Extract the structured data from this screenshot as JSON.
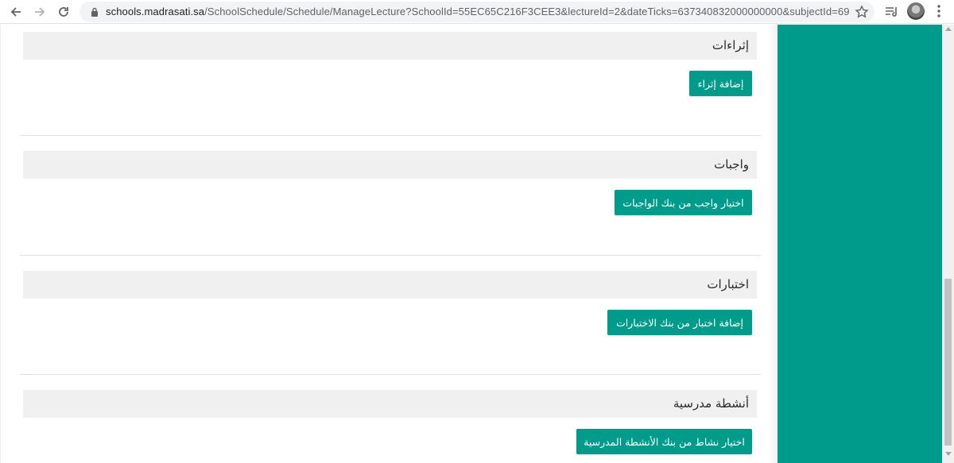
{
  "browser": {
    "url_host": "schools.madrasati.sa",
    "url_path": "/SchoolSchedule/Schedule/ManageLecture?SchoolId=55EC65C216F3CEE3&lectureId=2&dateTicks=637340832000000000&subjectId=69...",
    "back_icon": "arrow-left-icon",
    "forward_icon": "arrow-right-icon",
    "reload_icon": "reload-icon",
    "lock_icon": "lock-icon",
    "bookmark_icon": "star-icon",
    "menu_icon": "vertical-dots-icon"
  },
  "sections": [
    {
      "title": "إثراءات",
      "button_label": "إضافة إثراء"
    },
    {
      "title": "واجبات",
      "button_label": "اختيار واجب من بنك الواجبات"
    },
    {
      "title": "اختبارات",
      "button_label": "إضافة اختبار من بنك الاختبارات"
    },
    {
      "title": "أنشطة مدرسية",
      "button_label": "اختيار نشاط من بنك الأنشطة المدرسية"
    }
  ],
  "colors": {
    "accent": "#009b8a",
    "header_bg": "#f0f0f0"
  }
}
